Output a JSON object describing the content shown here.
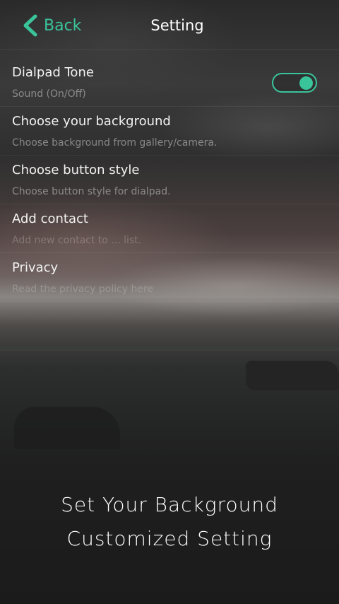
{
  "header": {
    "back_label": "Back",
    "title": "Setting"
  },
  "settings": {
    "items": [
      {
        "title": "Dialpad Tone",
        "subtitle": "Sound (On/Off)",
        "toggle_on": true
      },
      {
        "title": "Choose your background",
        "subtitle": "Choose background from gallery/camera."
      },
      {
        "title": "Choose button style",
        "subtitle": "Choose button style for dialpad."
      },
      {
        "title": "Add contact",
        "subtitle": "Add new contact to ... list."
      },
      {
        "title": "Privacy",
        "subtitle": "Read the privacy policy here"
      }
    ]
  },
  "promo": {
    "line1": "Set Your Background",
    "line2": "Customized Setting"
  },
  "colors": {
    "accent": "#3ac49a",
    "background": "#1b1b1b"
  },
  "icons": {
    "back": "chevron-left-icon"
  }
}
